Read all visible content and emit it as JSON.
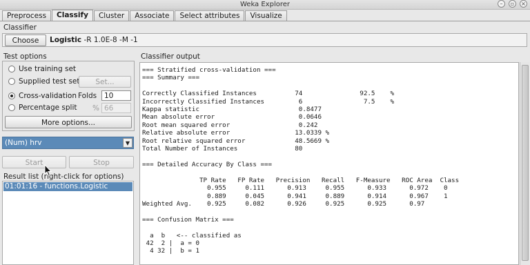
{
  "window": {
    "title": "Weka Explorer"
  },
  "tabs": [
    {
      "label": "Preprocess",
      "active": false
    },
    {
      "label": "Classify",
      "active": true
    },
    {
      "label": "Cluster",
      "active": false
    },
    {
      "label": "Associate",
      "active": false
    },
    {
      "label": "Select attributes",
      "active": false
    },
    {
      "label": "Visualize",
      "active": false
    }
  ],
  "classifier": {
    "section_label": "Classifier",
    "choose_label": "Choose",
    "name": "Logistic",
    "options": "-R 1.0E-8 -M -1"
  },
  "test_options": {
    "section_label": "Test options",
    "use_training_set": "Use training set",
    "supplied_test_set": "Supplied test set",
    "set_button": "Set...",
    "cross_validation": "Cross-validation",
    "folds_label": "Folds",
    "folds_value": "10",
    "percentage_split": "Percentage split",
    "percent_sign": "%",
    "percent_value": "66",
    "selected": "cross_validation",
    "more_options": "More options..."
  },
  "class_attribute": {
    "value": "(Num) hrv"
  },
  "controls": {
    "start": "Start",
    "stop": "Stop"
  },
  "result_list": {
    "label": "Result list (right-click for options)",
    "items": [
      "01:01:16 - functions.Logistic"
    ]
  },
  "output": {
    "label": "Classifier output",
    "lines": [
      "=== Stratified cross-validation ===",
      "=== Summary ===",
      "",
      "Correctly Classified Instances          74               92.5    %",
      "Incorrectly Classified Instances         6                7.5    %",
      "Kappa statistic                          0.8477",
      "Mean absolute error                      0.0646",
      "Root mean squared error                  0.242",
      "Relative absolute error                 13.0339 %",
      "Root relative squared error             48.5669 %",
      "Total Number of Instances               80",
      "",
      "=== Detailed Accuracy By Class ===",
      "",
      "               TP Rate   FP Rate   Precision   Recall   F-Measure   ROC Area  Class",
      "                 0.955     0.111      0.913     0.955      0.933      0.972    0",
      "                 0.889     0.045      0.941     0.889      0.914      0.967    1",
      "Weighted Avg.    0.925     0.082      0.926     0.925      0.925      0.97",
      "",
      "=== Confusion Matrix ===",
      "",
      "  a  b   <-- classified as",
      " 42  2 |  a = 0",
      "  4 32 |  b = 1"
    ]
  },
  "colors": {
    "selection": "#5b8ab8",
    "panel_bg": "#e8e8e8"
  }
}
